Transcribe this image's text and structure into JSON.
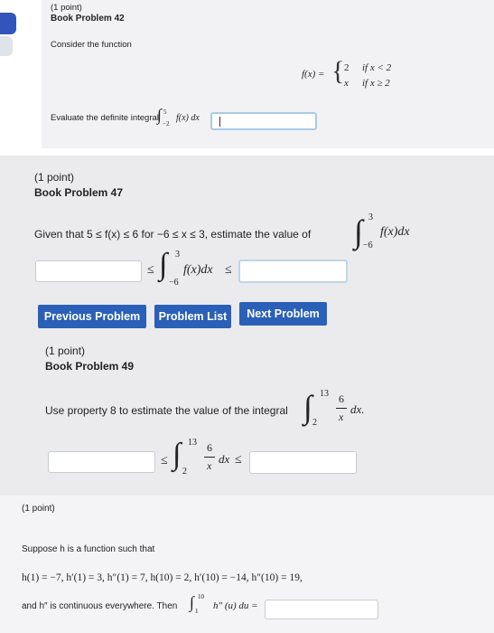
{
  "problem42": {
    "points": "(1 point)",
    "title": "Book Problem 42",
    "intro": "Consider the function",
    "fx": "f(x) =",
    "case1_val": "2",
    "case1_cond": "if x < 2",
    "case2_val": "x",
    "case2_cond": "if x ≥ 2",
    "question": "Evaluate the definite integral",
    "int_upper": "5",
    "int_lower": "−2",
    "integrand": "f(x) dx"
  },
  "problem47": {
    "points": "(1 point)",
    "title": "Book Problem 47",
    "question": "Given that 5 ≤ f(x) ≤ 6 for −6 ≤ x ≤ 3, estimate the value of",
    "int_upper": "3",
    "int_lower": "−6",
    "integrand": "f(x)dx",
    "le1": "≤",
    "le2": "≤"
  },
  "nav": {
    "previous": "Previous Problem",
    "list": "Problem List",
    "next": "Next Problem"
  },
  "problem49": {
    "points": "(1 point)",
    "title": "Book Problem 49",
    "question": "Use property 8 to estimate the value of the integral",
    "int_upper": "13",
    "int_lower": "2",
    "numerator": "6",
    "denominator": "x",
    "dx": "dx.",
    "dx2": "dx",
    "le1": "≤",
    "le2": "≤"
  },
  "problem_h": {
    "points": "(1 point)",
    "intro": "Suppose h is a function such that",
    "values": "h(1) = −7, h′(1) = 3, h″(1) = 7, h(10) = 2, h′(10) = −14, h″(10) = 19,",
    "question": "and h″ is continuous everywhere. Then",
    "int_upper": "10",
    "int_lower": "1",
    "integrand": "h″ (u) du ="
  }
}
